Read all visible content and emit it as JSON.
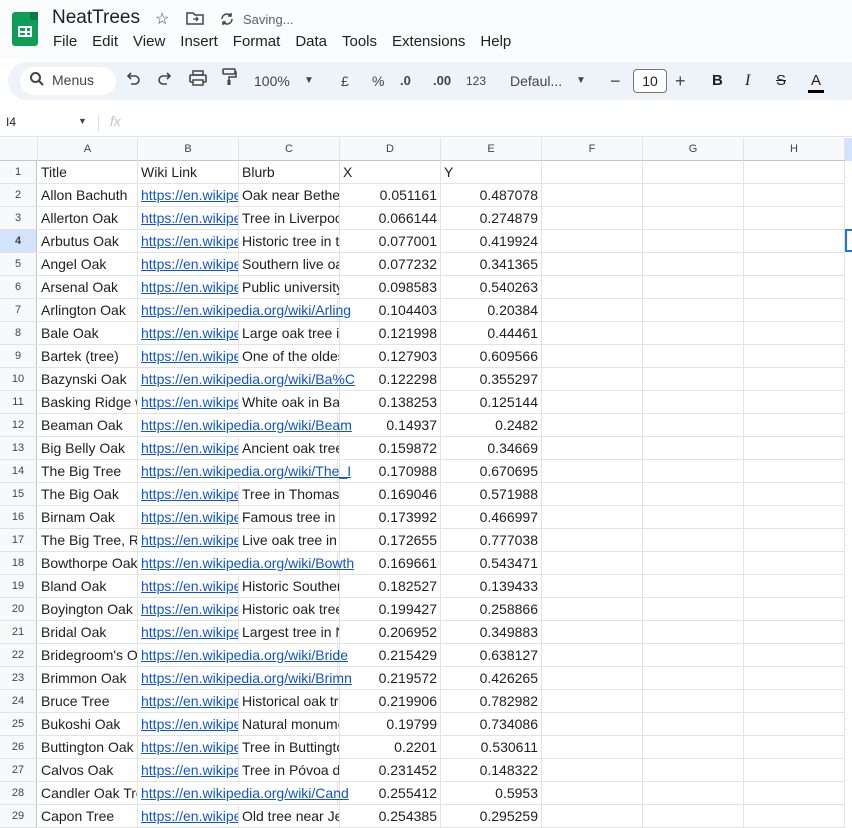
{
  "app": {
    "doc_title": "NeatTrees",
    "saving_text": "Saving..."
  },
  "menu": [
    "File",
    "Edit",
    "View",
    "Insert",
    "Format",
    "Data",
    "Tools",
    "Extensions",
    "Help"
  ],
  "toolbar": {
    "search_label": "Menus",
    "zoom": "100%",
    "currency": "£",
    "percent": "%",
    "dec_decrease": ".0",
    "dec_increase": ".00",
    "format_123": "123",
    "font": "Defaul...",
    "font_size": "10",
    "bold": "B",
    "italic": "I",
    "strike": "S",
    "text_color": "A"
  },
  "formula_bar": {
    "cell_ref": "I4",
    "fx": "fx"
  },
  "columns": [
    "A",
    "B",
    "C",
    "D",
    "E",
    "F",
    "G",
    "H"
  ],
  "rows": [
    [
      "Title",
      "Wiki Link",
      "Blurb",
      "X",
      "Y"
    ],
    [
      "Allon Bachuth",
      "https://en.wikipe",
      "Oak near Bethel",
      "0.051161",
      "0.487078"
    ],
    [
      "Allerton Oak",
      "https://en.wikipe",
      "Tree in Liverpool",
      "0.066144",
      "0.274879"
    ],
    [
      "Arbutus Oak",
      "https://en.wikipe",
      "Historic tree in th",
      "0.077001",
      "0.419924"
    ],
    [
      "Angel Oak",
      "https://en.wikipe",
      "Southern live oa",
      "0.077232",
      "0.341365"
    ],
    [
      "Arsenal Oak",
      "https://en.wikipe",
      "Public university",
      "0.098583",
      "0.540263"
    ],
    [
      "Arlington Oak",
      "https://en.wikipedia.org/wiki/Arling",
      "",
      "0.104403",
      "0.20384"
    ],
    [
      "Bale Oak",
      "https://en.wikipe",
      "Large oak tree in",
      "0.121998",
      "0.44461"
    ],
    [
      "Bartek (tree)",
      "https://en.wikipe",
      "One of the oldes",
      "0.127903",
      "0.609566"
    ],
    [
      "Bazynski Oak",
      "https://en.wikipedia.org/wiki/Ba%C",
      "",
      "0.122298",
      "0.355297"
    ],
    [
      "Basking Ridge w",
      "https://en.wikipe",
      "White oak in Bas",
      "0.138253",
      "0.125144"
    ],
    [
      "Beaman Oak",
      "https://en.wikipedia.org/wiki/Beam",
      "",
      "0.14937",
      "0.2482"
    ],
    [
      "Big Belly Oak",
      "https://en.wikipe",
      "Ancient oak tree",
      "0.159872",
      "0.34669"
    ],
    [
      "The Big Tree",
      "https://en.wikipedia.org/wiki/The_I",
      "",
      "0.170988",
      "0.670695"
    ],
    [
      "The Big Oak",
      "https://en.wikipe",
      "Tree in Thomasv",
      "0.169046",
      "0.571988"
    ],
    [
      "Birnam Oak",
      "https://en.wikipe",
      "Famous tree in P",
      "0.173992",
      "0.466997"
    ],
    [
      "The Big Tree, Ro",
      "https://en.wikipe",
      "Live oak tree in T",
      "0.172655",
      "0.777038"
    ],
    [
      "Bowthorpe Oak",
      "https://en.wikipedia.org/wiki/Bowth",
      "",
      "0.169661",
      "0.543471"
    ],
    [
      "Bland Oak",
      "https://en.wikipe",
      "Historic Southern",
      "0.182527",
      "0.139433"
    ],
    [
      "Boyington Oak",
      "https://en.wikipe",
      "Historic oak tree",
      "0.199427",
      "0.258866"
    ],
    [
      "Bridal Oak",
      "https://en.wikipe",
      "Largest tree in N",
      "0.206952",
      "0.349883"
    ],
    [
      "Bridegroom's Oa",
      "https://en.wikipedia.org/wiki/Bride",
      "",
      "0.215429",
      "0.638127"
    ],
    [
      "Brimmon Oak",
      "https://en.wikipedia.org/wiki/Brimn",
      "",
      "0.219572",
      "0.426265"
    ],
    [
      "Bruce Tree",
      "https://en.wikipe",
      "Historical oak tre",
      "0.219906",
      "0.782982"
    ],
    [
      "Bukoshi Oak",
      "https://en.wikipe",
      "Natural monume",
      "0.19799",
      "0.734086"
    ],
    [
      "Buttington Oak",
      "https://en.wikipe",
      "Tree in Buttingto",
      "0.2201",
      "0.530611"
    ],
    [
      "Calvos Oak",
      "https://en.wikipe",
      "Tree in Póvoa de",
      "0.231452",
      "0.148322"
    ],
    [
      "Candler Oak Tre",
      "https://en.wikipedia.org/wiki/Cand",
      "",
      "0.255412",
      "0.5953"
    ],
    [
      "Capon Tree",
      "https://en.wikipe",
      "Old tree near Je",
      "0.254385",
      "0.295259"
    ]
  ]
}
